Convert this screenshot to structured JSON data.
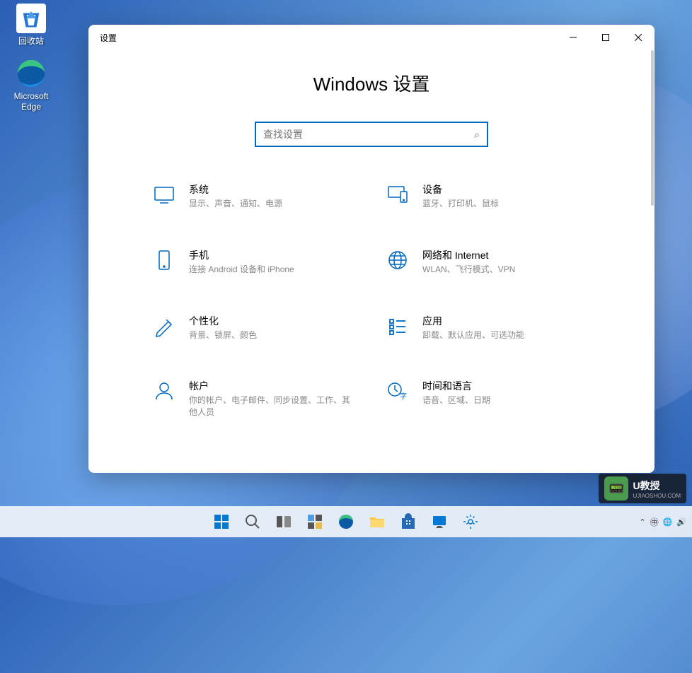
{
  "desktop": {
    "recycle_bin": "回收站",
    "edge": "Microsoft Edge"
  },
  "window": {
    "title": "设置",
    "page_title": "Windows 设置",
    "search_placeholder": "查找设置"
  },
  "settings": {
    "system": {
      "title": "系统",
      "desc": "显示、声音、通知、电源"
    },
    "devices": {
      "title": "设备",
      "desc": "蓝牙、打印机、鼠标"
    },
    "phone": {
      "title": "手机",
      "desc": "连接 Android 设备和 iPhone"
    },
    "network": {
      "title": "网络和 Internet",
      "desc": "WLAN、飞行模式、VPN"
    },
    "personalization": {
      "title": "个性化",
      "desc": "背景、锁屏、颜色"
    },
    "apps": {
      "title": "应用",
      "desc": "卸载、默认应用、可选功能"
    },
    "accounts": {
      "title": "帐户",
      "desc": "你的帐户、电子邮件、同步设置、工作、其他人员"
    },
    "time": {
      "title": "时间和语言",
      "desc": "语音、区域、日期"
    }
  },
  "watermark": {
    "name": "U教授"
  }
}
